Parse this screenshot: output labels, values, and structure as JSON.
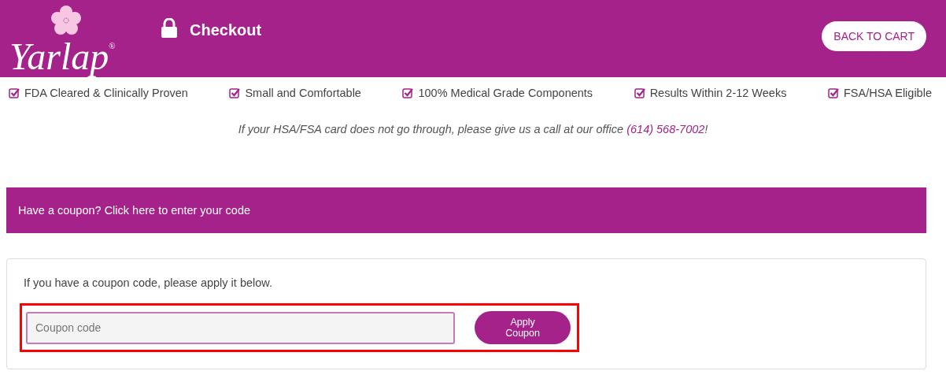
{
  "header": {
    "logo": "Yarlap$^{®}$",
    "title": "Checkout",
    "back_button": "BACK TO CART"
  },
  "features": [
    {
      "label": "FDA Cleared & Clinically Proven",
      "checked": true
    },
    {
      "label": "Small and Comfortable",
      "checked": true
    },
    {
      "label": "100% Medical Grade Components",
      "checked": true
    },
    {
      "label": "Results Within 2-12 Weeks",
      "checked": true
    },
    {
      "label": "FSA/HSA Eligible",
      "checked": true
    }
  ],
  "notice": {
    "text": "If your HSA/FSA card does not go through, please give us a call at our office ",
    "phone": "(614) 568-7002",
    "suffix": "!"
  },
  "coupon_bar": {
    "text": "Have a coupon? Click here to enter your code"
  },
  "coupon_form": {
    "instructions": "If you have a coupon code, please apply it below.",
    "placeholder": "Coupon code",
    "button": "Apply Coupon",
    "highlighted": true
  }
}
